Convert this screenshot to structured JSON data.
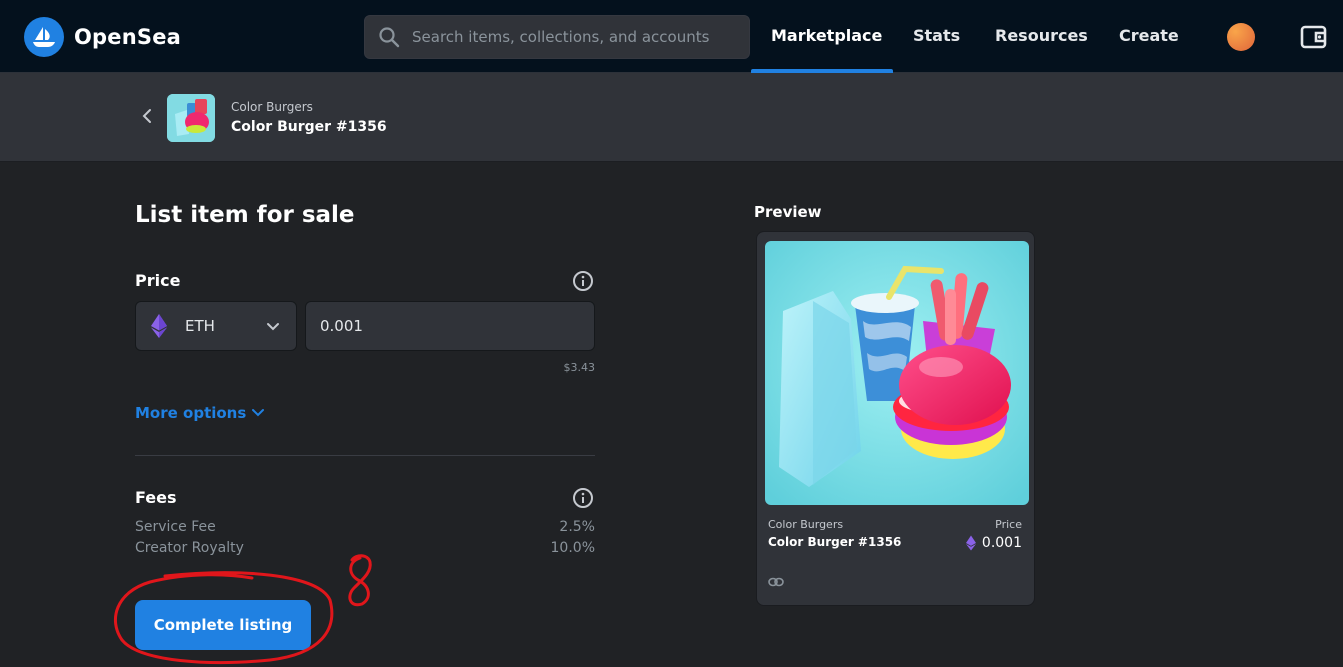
{
  "brand": {
    "name": "OpenSea",
    "accent": "#2081e2"
  },
  "search": {
    "placeholder": "Search items, collections, and accounts"
  },
  "nav": {
    "items": [
      {
        "label": "Marketplace",
        "active": true
      },
      {
        "label": "Stats"
      },
      {
        "label": "Resources"
      },
      {
        "label": "Create"
      }
    ]
  },
  "item": {
    "collection": "Color Burgers",
    "name": "Color Burger #1356"
  },
  "form": {
    "title": "List item for sale",
    "price_label": "Price",
    "currency": "ETH",
    "amount": "0.001",
    "usd_value": "$3.43",
    "more_options": "More options",
    "fees_label": "Fees",
    "fees": [
      {
        "name": "Service Fee",
        "value": "2.5%"
      },
      {
        "name": "Creator Royalty",
        "value": "10.0%"
      }
    ],
    "submit_label": "Complete listing"
  },
  "preview": {
    "label": "Preview",
    "price_label": "Price",
    "price": "0.001"
  },
  "annotation": {
    "step": "8",
    "color": "#e0161b"
  }
}
